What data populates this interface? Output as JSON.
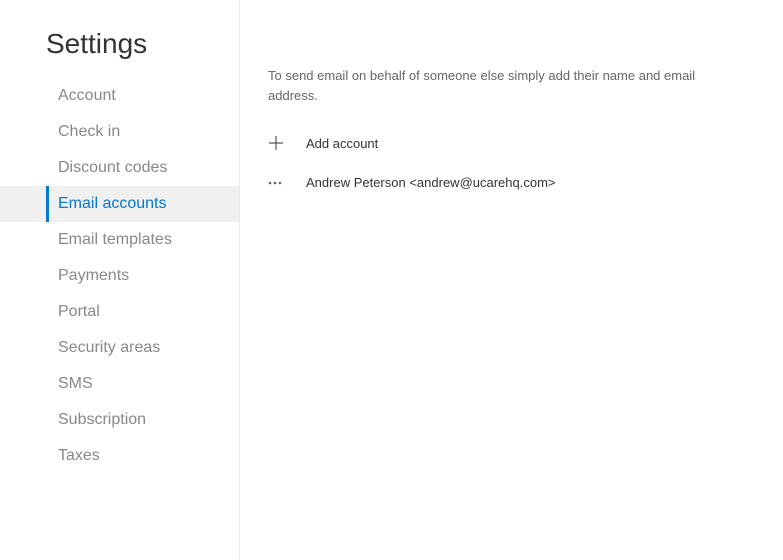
{
  "page_title": "Settings",
  "sidebar": {
    "items": [
      {
        "label": "Account",
        "slug": "account",
        "active": false
      },
      {
        "label": "Check in",
        "slug": "check-in",
        "active": false
      },
      {
        "label": "Discount codes",
        "slug": "discount-codes",
        "active": false
      },
      {
        "label": "Email accounts",
        "slug": "email-accounts",
        "active": true
      },
      {
        "label": "Email templates",
        "slug": "email-templates",
        "active": false
      },
      {
        "label": "Payments",
        "slug": "payments",
        "active": false
      },
      {
        "label": "Portal",
        "slug": "portal",
        "active": false
      },
      {
        "label": "Security areas",
        "slug": "security-areas",
        "active": false
      },
      {
        "label": "SMS",
        "slug": "sms",
        "active": false
      },
      {
        "label": "Subscription",
        "slug": "subscription",
        "active": false
      },
      {
        "label": "Taxes",
        "slug": "taxes",
        "active": false
      }
    ]
  },
  "main": {
    "description": "To send email on behalf of someone else simply add their name and email address.",
    "add_label": "Add account",
    "accounts": [
      {
        "display": "Andrew Peterson <andrew@ucarehq.com>"
      }
    ]
  }
}
